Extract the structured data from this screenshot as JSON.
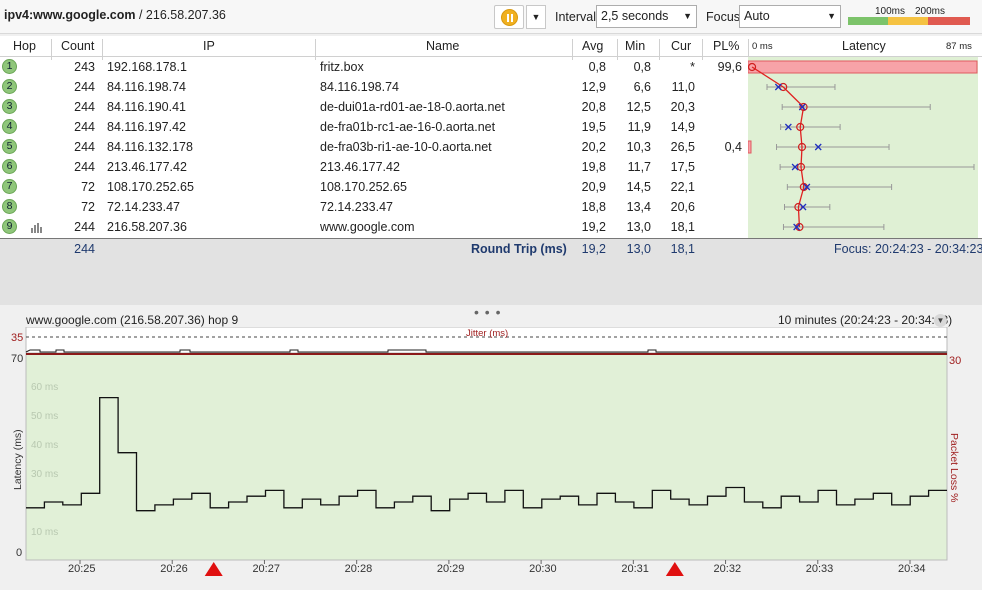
{
  "toolbar": {
    "target_host": "ipv4:www.google.com",
    "target_ip": "/ 216.58.207.36",
    "interval_label": "Interval",
    "interval_value": "2,5 seconds",
    "focus_label": "Focus",
    "focus_value": "Auto",
    "legend_100": "100ms",
    "legend_200": "200ms",
    "legend_colors": [
      "#7cc36a",
      "#f5c242",
      "#e05a50"
    ]
  },
  "table": {
    "headers": {
      "hop": "Hop",
      "count": "Count",
      "ip": "IP",
      "name": "Name",
      "avg": "Avg",
      "min": "Min",
      "cur": "Cur",
      "pl": "PL%",
      "latency": "Latency",
      "lat_min": "0 ms",
      "lat_max": "87 ms"
    },
    "rows": [
      {
        "hop": "1",
        "count": "243",
        "ip": "192.168.178.1",
        "name": "fritz.box",
        "avg": "0,8",
        "min": "0,8",
        "cur": "*",
        "pl": "99,6"
      },
      {
        "hop": "2",
        "count": "244",
        "ip": "84.116.198.74",
        "name": "84.116.198.74",
        "avg": "12,9",
        "min": "6,6",
        "cur": "11,0",
        "pl": ""
      },
      {
        "hop": "3",
        "count": "244",
        "ip": "84.116.190.41",
        "name": "de-dui01a-rd01-ae-18-0.aorta.net",
        "avg": "20,8",
        "min": "12,5",
        "cur": "20,3",
        "pl": ""
      },
      {
        "hop": "4",
        "count": "244",
        "ip": "84.116.197.42",
        "name": "de-fra01b-rc1-ae-16-0.aorta.net",
        "avg": "19,5",
        "min": "11,9",
        "cur": "14,9",
        "pl": ""
      },
      {
        "hop": "5",
        "count": "244",
        "ip": "84.116.132.178",
        "name": "de-fra03b-ri1-ae-10-0.aorta.net",
        "avg": "20,2",
        "min": "10,3",
        "cur": "26,5",
        "pl": "0,4"
      },
      {
        "hop": "6",
        "count": "244",
        "ip": "213.46.177.42",
        "name": "213.46.177.42",
        "avg": "19,8",
        "min": "11,7",
        "cur": "17,5",
        "pl": ""
      },
      {
        "hop": "7",
        "count": "72",
        "ip": "108.170.252.65",
        "name": "108.170.252.65",
        "avg": "20,9",
        "min": "14,5",
        "cur": "22,1",
        "pl": ""
      },
      {
        "hop": "8",
        "count": "72",
        "ip": "72.14.233.47",
        "name": "72.14.233.47",
        "avg": "18,8",
        "min": "13,4",
        "cur": "20,6",
        "pl": ""
      },
      {
        "hop": "9",
        "count": "244",
        "ip": "216.58.207.36",
        "name": "www.google.com",
        "avg": "19,2",
        "min": "13,0",
        "cur": "18,1",
        "pl": ""
      }
    ],
    "latency_marks": [
      {
        "avg": 0.8,
        "min": 0.8,
        "max": 0.8,
        "cur": null
      },
      {
        "avg": 12.9,
        "min": 6.6,
        "max": 33,
        "cur": 11.0
      },
      {
        "avg": 20.8,
        "min": 12.5,
        "max": 70,
        "cur": 20.3
      },
      {
        "avg": 19.5,
        "min": 11.9,
        "max": 35,
        "cur": 14.9
      },
      {
        "avg": 20.2,
        "min": 10.3,
        "max": 54,
        "cur": 26.5
      },
      {
        "avg": 19.8,
        "min": 11.7,
        "max": 87,
        "cur": 17.5
      },
      {
        "avg": 20.9,
        "min": 14.5,
        "max": 55,
        "cur": 22.1
      },
      {
        "avg": 18.8,
        "min": 13.4,
        "max": 31,
        "cur": 20.6
      },
      {
        "avg": 19.2,
        "min": 13.0,
        "max": 52,
        "cur": 18.1
      }
    ],
    "summary": {
      "count": "244",
      "label": "Round Trip (ms)",
      "avg": "19,2",
      "min": "13,0",
      "cur": "18,1",
      "focus": "Focus: 20:24:23 - 20:34:23"
    }
  },
  "chart": {
    "title": "www.google.com (216.58.207.36) hop 9",
    "range": "10 minutes (20:24:23 - 20:34:23)",
    "jitter_label": "Jitter (ms)",
    "jitter_max": "35",
    "ylabel": "Latency (ms)",
    "y2label": "Packet Loss %",
    "y_top": "70",
    "y_bottom": "0",
    "y2_top": "30",
    "watermarks": [
      "60 ms",
      "50 ms",
      "40 ms",
      "30 ms",
      "10 ms"
    ],
    "xticks": [
      "20:25",
      "20:26",
      "20:27",
      "20:28",
      "20:29",
      "20:30",
      "20:31",
      "20:32",
      "20:33",
      "20:34"
    ],
    "loss_markers_at": [
      "20:26.5",
      "20:31.5"
    ]
  },
  "chart_data": {
    "type": "line",
    "title": "",
    "xlabel": "",
    "ylabel": "Latency (ms)",
    "ylim": [
      0,
      70
    ],
    "x": [
      "20:25",
      "20:26",
      "20:27",
      "20:28",
      "20:29",
      "20:30",
      "20:31",
      "20:32",
      "20:33",
      "20:34"
    ],
    "series": [
      {
        "name": "",
        "values": [
          18,
          20,
          19,
          23,
          56,
          37,
          17,
          19,
          21,
          23,
          18,
          20,
          22,
          24,
          18,
          21,
          19,
          22,
          24,
          18,
          20,
          22,
          17,
          21,
          23,
          20,
          24,
          18,
          21,
          22,
          19,
          23,
          20,
          18,
          24,
          21,
          19,
          22,
          25,
          20,
          18,
          22,
          20,
          24,
          19,
          21,
          23,
          19,
          22,
          24
        ]
      }
    ]
  }
}
